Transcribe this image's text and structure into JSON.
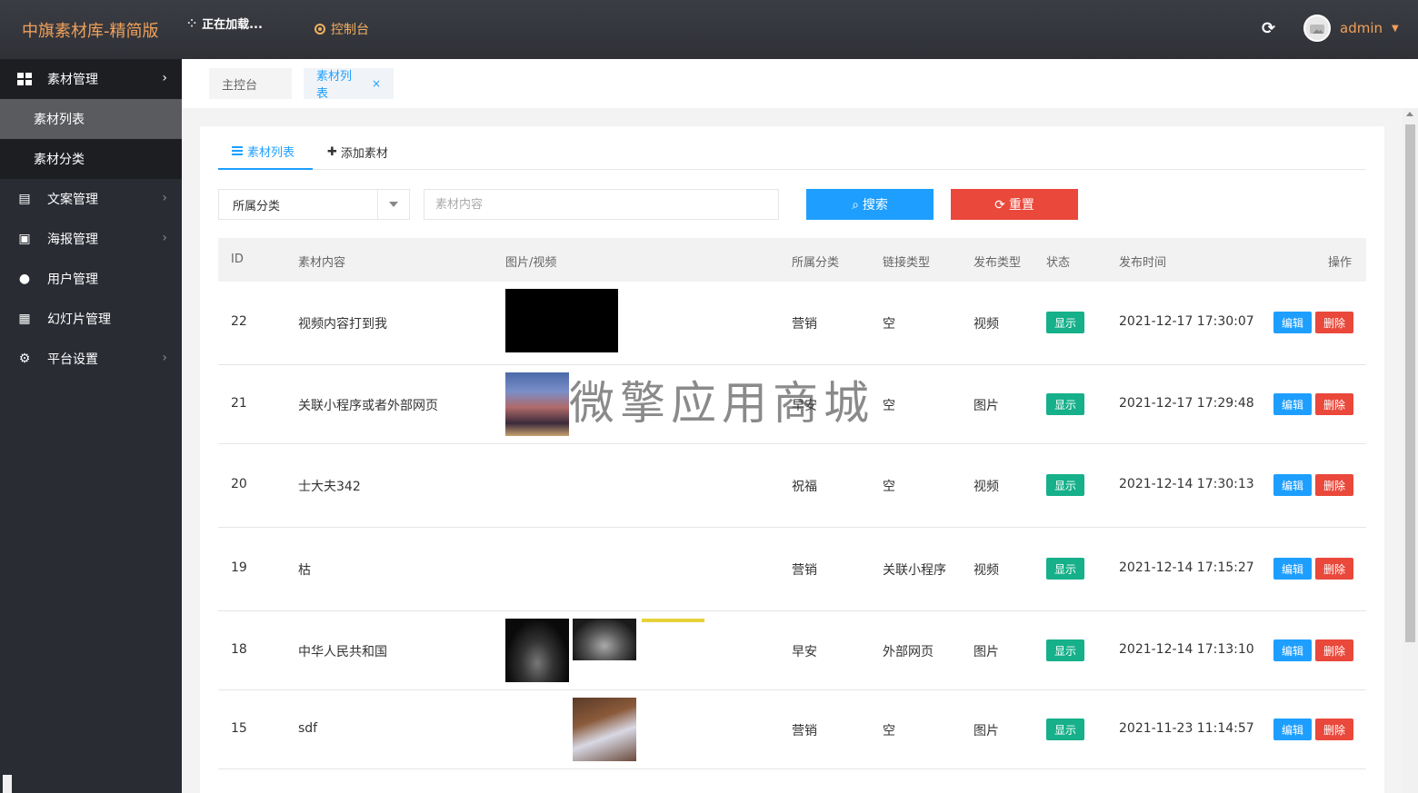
{
  "app": {
    "brand": "中旗素材库-精简版",
    "loading_text": "正在加载...",
    "console_label": "控制台",
    "refresh_icon": "refresh-icon",
    "username": "admin"
  },
  "sidebar": {
    "items": [
      {
        "label": "素材管理",
        "icon": "grid-icon",
        "open": true,
        "children": [
          {
            "label": "素材列表",
            "active": true
          },
          {
            "label": "素材分类",
            "active": false
          }
        ]
      },
      {
        "label": "文案管理",
        "icon": "book-icon"
      },
      {
        "label": "海报管理",
        "icon": "image-file-icon"
      },
      {
        "label": "用户管理",
        "icon": "users-icon"
      },
      {
        "label": "幻灯片管理",
        "icon": "slides-icon"
      },
      {
        "label": "平台设置",
        "icon": "gear-icon"
      }
    ]
  },
  "tabs": {
    "home": "主控台",
    "current": "素材列表",
    "close": "×"
  },
  "subtabs": {
    "list": "素材列表",
    "add": "添加素材"
  },
  "filters": {
    "category_value": "所属分类",
    "content_placeholder": "素材内容",
    "search_label": "搜索",
    "reset_label": "重置"
  },
  "table": {
    "columns": [
      "ID",
      "素材内容",
      "图片/视频",
      "所属分类",
      "链接类型",
      "发布类型",
      "状态",
      "发布时间",
      "操作"
    ],
    "status_label": "显示",
    "edit_label": "编辑",
    "delete_label": "删除",
    "rows": [
      {
        "id": "22",
        "content": "视频内容打到我",
        "category": "营销",
        "link_type": "空",
        "publish_type": "视频",
        "time": "2021-12-17 17:30:07"
      },
      {
        "id": "21",
        "content": "关联小程序或者外部网页",
        "category": "早安",
        "link_type": "空",
        "publish_type": "图片",
        "time": "2021-12-17 17:29:48"
      },
      {
        "id": "20",
        "content": "士大夫342",
        "category": "祝福",
        "link_type": "空",
        "publish_type": "视频",
        "time": "2021-12-14 17:30:13"
      },
      {
        "id": "19",
        "content": "枯",
        "category": "营销",
        "link_type": "关联小程序",
        "publish_type": "视频",
        "time": "2021-12-14 17:15:27"
      },
      {
        "id": "18",
        "content": "中华人民共和国",
        "category": "早安",
        "link_type": "外部网页",
        "publish_type": "图片",
        "time": "2021-12-14 17:13:10"
      },
      {
        "id": "15",
        "content": "sdf",
        "category": "营销",
        "link_type": "空",
        "publish_type": "图片",
        "time": "2021-11-23 11:14:57"
      }
    ]
  },
  "watermark": "微擎应用商城",
  "colors": {
    "accent": "#1e9fff",
    "danger": "#e9483b",
    "status": "#16b08a",
    "brand": "#f0a05a"
  }
}
